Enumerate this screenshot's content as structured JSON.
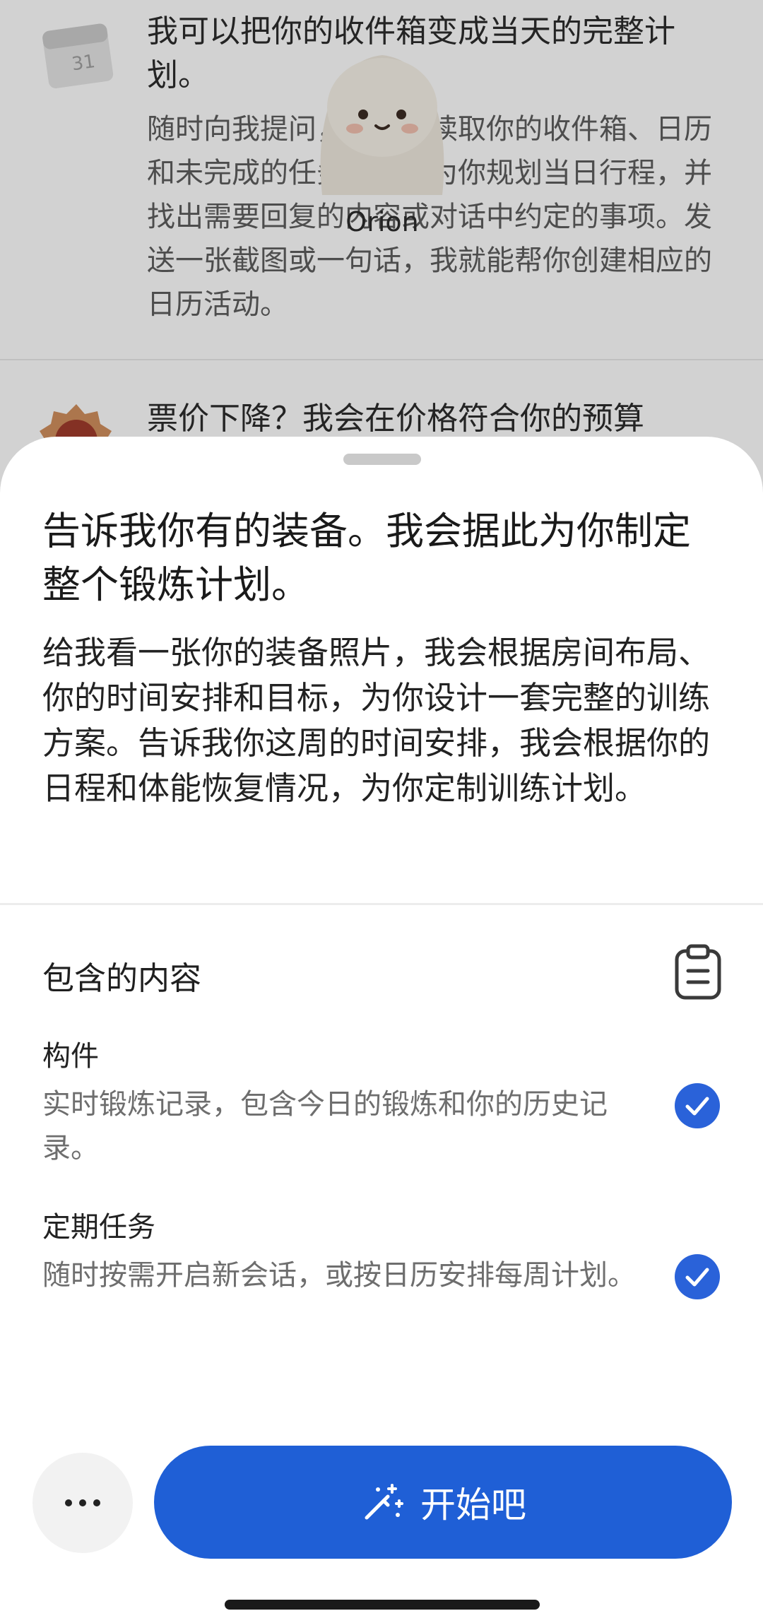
{
  "background": {
    "item1": {
      "title": "我可以把你的收件箱变成当天的完整计划。",
      "description": "随时向我提问，我可以读取你的收件箱、日历和未完成的任务，据此为你规划当日行程，并找出需要回复的内容或对话中约定的事项。发送一张截图或一句话，我就能帮你创建相应的日历活动。"
    },
    "item2": {
      "title": "票价下降？我会在价格符合你的预算"
    },
    "assistant_name": "Orion"
  },
  "sheet": {
    "title": "告诉我你有的装备。我会据此为你制定整个锻炼计划。",
    "description": "给我看一张你的装备照片，我会根据房间布局、你的时间安排和目标，为你设计一套完整的训练方案。告诉我你这周的时间安排，我会根据你的日程和体能恢复情况，为你定制训练计划。",
    "section_label": "包含的内容",
    "features": [
      {
        "name": "构件",
        "description": "实时锻炼记录，包含今日的锻炼和你的历史记录。",
        "checked": true
      },
      {
        "name": "定期任务",
        "description": "随时按需开启新会话，或按日历安排每周计划。",
        "checked": true
      }
    ]
  },
  "actions": {
    "start_label": "开始吧"
  },
  "colors": {
    "accent": "#1f5fd6",
    "check": "#2a62d9"
  }
}
